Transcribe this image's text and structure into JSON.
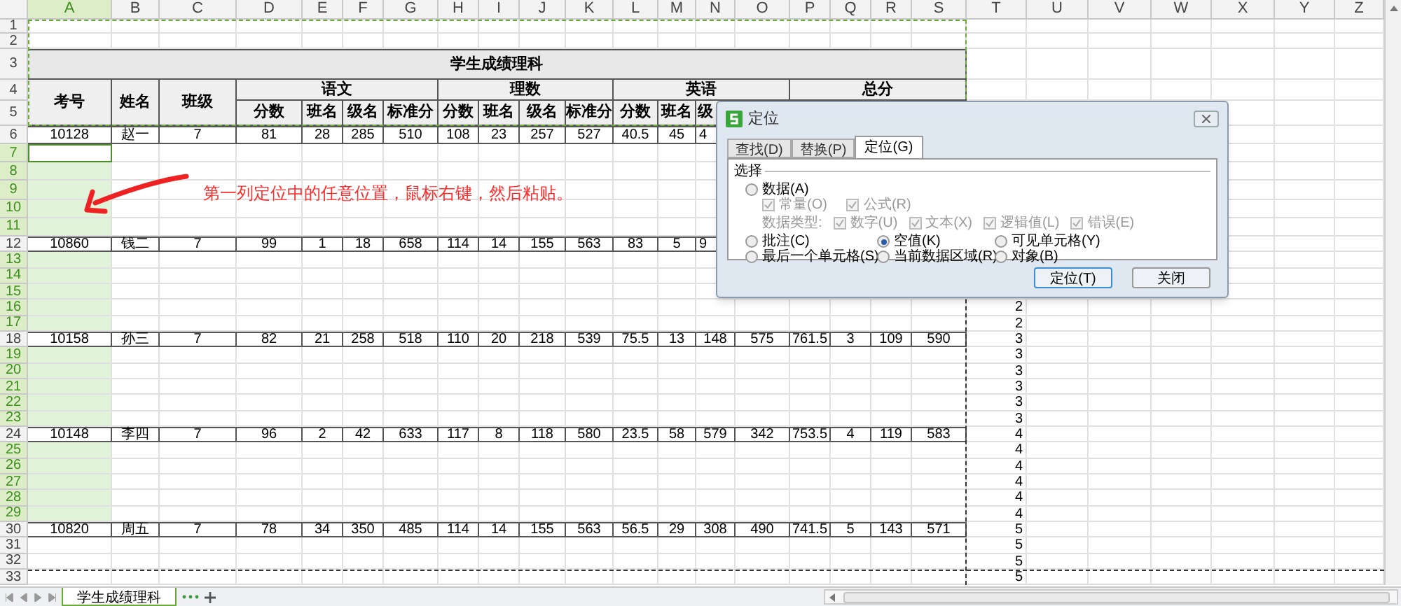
{
  "column_headers": [
    {
      "label": "A",
      "selected": true
    },
    {
      "label": "B",
      "selected": false
    },
    {
      "label": "C",
      "selected": false
    },
    {
      "label": "D",
      "selected": false
    },
    {
      "label": "E",
      "selected": false
    },
    {
      "label": "F",
      "selected": false
    },
    {
      "label": "G",
      "selected": false
    },
    {
      "label": "H",
      "selected": false
    },
    {
      "label": "I",
      "selected": false
    },
    {
      "label": "J",
      "selected": false
    },
    {
      "label": "K",
      "selected": false
    },
    {
      "label": "L",
      "selected": false
    },
    {
      "label": "M",
      "selected": false
    },
    {
      "label": "N",
      "selected": false
    },
    {
      "label": "O",
      "selected": false
    },
    {
      "label": "P",
      "selected": false
    },
    {
      "label": "Q",
      "selected": false
    },
    {
      "label": "R",
      "selected": false
    },
    {
      "label": "S",
      "selected": false
    },
    {
      "label": "T",
      "selected": false
    },
    {
      "label": "U",
      "selected": false
    },
    {
      "label": "V",
      "selected": false
    },
    {
      "label": "W",
      "selected": false
    },
    {
      "label": "X",
      "selected": false
    },
    {
      "label": "Y",
      "selected": false
    },
    {
      "label": "Z",
      "selected": false
    }
  ],
  "row_headers": [
    {
      "label": "1",
      "selected": false
    },
    {
      "label": "2",
      "selected": false
    },
    {
      "label": "3",
      "selected": false
    },
    {
      "label": "4",
      "selected": false
    },
    {
      "label": "5",
      "selected": false
    },
    {
      "label": "6",
      "selected": false
    },
    {
      "label": "7",
      "selected": true
    },
    {
      "label": "8",
      "selected": true
    },
    {
      "label": "9",
      "selected": true
    },
    {
      "label": "10",
      "selected": true
    },
    {
      "label": "11",
      "selected": true
    },
    {
      "label": "12",
      "selected": false
    },
    {
      "label": "13",
      "selected": true
    },
    {
      "label": "14",
      "selected": true
    },
    {
      "label": "15",
      "selected": true
    },
    {
      "label": "16",
      "selected": true
    },
    {
      "label": "17",
      "selected": true
    },
    {
      "label": "18",
      "selected": false
    },
    {
      "label": "19",
      "selected": true
    },
    {
      "label": "20",
      "selected": true
    },
    {
      "label": "21",
      "selected": true
    },
    {
      "label": "22",
      "selected": true
    },
    {
      "label": "23",
      "selected": true
    },
    {
      "label": "24",
      "selected": false
    },
    {
      "label": "25",
      "selected": true
    },
    {
      "label": "26",
      "selected": true
    },
    {
      "label": "27",
      "selected": true
    },
    {
      "label": "28",
      "selected": true
    },
    {
      "label": "29",
      "selected": true
    },
    {
      "label": "30",
      "selected": false
    },
    {
      "label": "31",
      "selected": false
    },
    {
      "label": "32",
      "selected": false
    },
    {
      "label": "33",
      "selected": false
    }
  ],
  "table": {
    "title": "学生成绩理科",
    "fixed_headers": [
      "考号",
      "姓名",
      "班级"
    ],
    "subject_headers": [
      "语文",
      "理数",
      "英语",
      "总分"
    ],
    "sub_headers": [
      "分数",
      "班名",
      "级名",
      "标准分",
      "分数",
      "班名",
      "级名",
      "标准分",
      "分数",
      "班名",
      "级"
    ],
    "rows": [
      {
        "cells": [
          "10128",
          "赵一",
          "7",
          "81",
          "28",
          "285",
          "510",
          "108",
          "23",
          "257",
          "527",
          "40.5",
          "45",
          "4"
        ]
      },
      {
        "cells": [
          "10860",
          "钱二",
          "7",
          "99",
          "1",
          "18",
          "658",
          "114",
          "14",
          "155",
          "563",
          "83",
          "5",
          "9"
        ]
      },
      {
        "cells": [
          "10158",
          "孙三",
          "7",
          "82",
          "21",
          "258",
          "518",
          "110",
          "20",
          "218",
          "539",
          "75.5",
          "13",
          "148",
          "575",
          "761.5",
          "3",
          "109",
          "590"
        ]
      },
      {
        "cells": [
          "10148",
          "李四",
          "7",
          "96",
          "2",
          "42",
          "633",
          "117",
          "8",
          "118",
          "580",
          "23.5",
          "58",
          "579",
          "342",
          "753.5",
          "4",
          "119",
          "583"
        ]
      },
      {
        "cells": [
          "10820",
          "周五",
          "7",
          "78",
          "34",
          "350",
          "485",
          "114",
          "14",
          "155",
          "563",
          "56.5",
          "29",
          "308",
          "490",
          "741.5",
          "5",
          "143",
          "571"
        ]
      }
    ]
  },
  "side_column": {
    "values": [
      "2",
      "2",
      "3",
      "3",
      "3",
      "3",
      "3",
      "3",
      "4",
      "4",
      "4",
      "4",
      "4",
      "4",
      "5",
      "5",
      "5",
      "5"
    ]
  },
  "annotation": {
    "text": "第一列定位中的任意位置，鼠标右键，然后粘贴。"
  },
  "dialog": {
    "title": "定位",
    "tabs": [
      {
        "label": "查找(D)",
        "selected": false
      },
      {
        "label": "替换(P)",
        "selected": false
      },
      {
        "label": "定位(G)",
        "selected": true
      }
    ],
    "group_label": "选择",
    "data_option": {
      "label": "数据(A)",
      "selected": false
    },
    "constant_options": [
      {
        "label": "常量(O)",
        "checked": true,
        "disabled": true
      },
      {
        "label": "公式(R)",
        "checked": true,
        "disabled": true
      }
    ],
    "data_type_label": "数据类型:",
    "data_types": [
      {
        "label": "数字(U)",
        "checked": true,
        "disabled": true
      },
      {
        "label": "文本(X)",
        "checked": true,
        "disabled": true
      },
      {
        "label": "逻辑值(L)",
        "checked": true,
        "disabled": true
      },
      {
        "label": "错误(E)",
        "checked": true,
        "disabled": true
      }
    ],
    "other_options": [
      {
        "label": "批注(C)",
        "selected": false
      },
      {
        "label": "空值(K)",
        "selected": true
      },
      {
        "label": "可见单元格(Y)",
        "selected": false
      },
      {
        "label": "最后一个单元格(S)",
        "selected": false
      },
      {
        "label": "当前数据区域(R)",
        "selected": false
      },
      {
        "label": "对象(B)",
        "selected": false
      }
    ],
    "buttons": [
      {
        "label": "定位(T)",
        "default": true
      },
      {
        "label": "关闭",
        "default": false
      }
    ]
  },
  "sheet_tabs": [
    {
      "label": "学生成绩理科",
      "selected": true
    }
  ]
}
